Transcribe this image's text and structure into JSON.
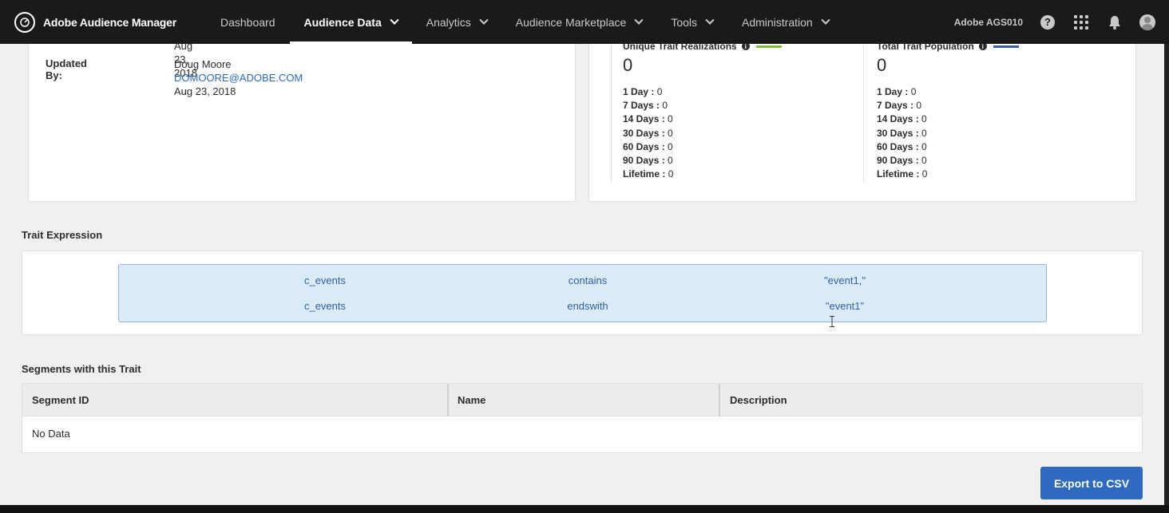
{
  "app": {
    "name": "Adobe Audience Manager"
  },
  "nav": {
    "items": [
      {
        "label": "Dashboard",
        "active": false,
        "dropdown": false
      },
      {
        "label": "Audience Data",
        "active": true,
        "dropdown": true
      },
      {
        "label": "Analytics",
        "active": false,
        "dropdown": true
      },
      {
        "label": "Audience Marketplace",
        "active": false,
        "dropdown": true
      },
      {
        "label": "Tools",
        "active": false,
        "dropdown": true
      },
      {
        "label": "Administration",
        "active": false,
        "dropdown": true
      }
    ],
    "org_name": "Adobe AGS010"
  },
  "details": {
    "created_date_partial": "Aug 23, 2018",
    "updated_by_label": "Updated By:",
    "updated_by_name": "Doug Moore",
    "updated_by_email": "DOMOORE@ADOBE.COM",
    "updated_date": "Aug 23, 2018"
  },
  "stats": {
    "unique": {
      "title": "Unique Trait Realizations",
      "value": "0",
      "color": "#7bbf3a",
      "rows": [
        {
          "label": "1 Day :",
          "value": "0"
        },
        {
          "label": "7 Days :",
          "value": "0"
        },
        {
          "label": "14 Days :",
          "value": "0"
        },
        {
          "label": "30 Days :",
          "value": "0"
        },
        {
          "label": "60 Days :",
          "value": "0"
        },
        {
          "label": "90 Days :",
          "value": "0"
        },
        {
          "label": "Lifetime :",
          "value": "0"
        }
      ]
    },
    "total": {
      "title": "Total Trait Population",
      "value": "0",
      "color": "#3c5ea8",
      "rows": [
        {
          "label": "1 Day :",
          "value": "0"
        },
        {
          "label": "7 Days :",
          "value": "0"
        },
        {
          "label": "14 Days :",
          "value": "0"
        },
        {
          "label": "30 Days :",
          "value": "0"
        },
        {
          "label": "60 Days :",
          "value": "0"
        },
        {
          "label": "90 Days :",
          "value": "0"
        },
        {
          "label": "Lifetime :",
          "value": "0"
        }
      ]
    }
  },
  "trait_expression": {
    "title": "Trait Expression",
    "rows": [
      {
        "field": "c_events",
        "operator": "contains",
        "value": "\"event1,\""
      },
      {
        "field": "c_events",
        "operator": "endswith",
        "value": "\"event1\""
      }
    ]
  },
  "segments": {
    "title": "Segments with this Trait",
    "columns": [
      "Segment ID",
      "Name",
      "Description"
    ],
    "empty_text": "No Data"
  },
  "export_label": "Export to CSV"
}
